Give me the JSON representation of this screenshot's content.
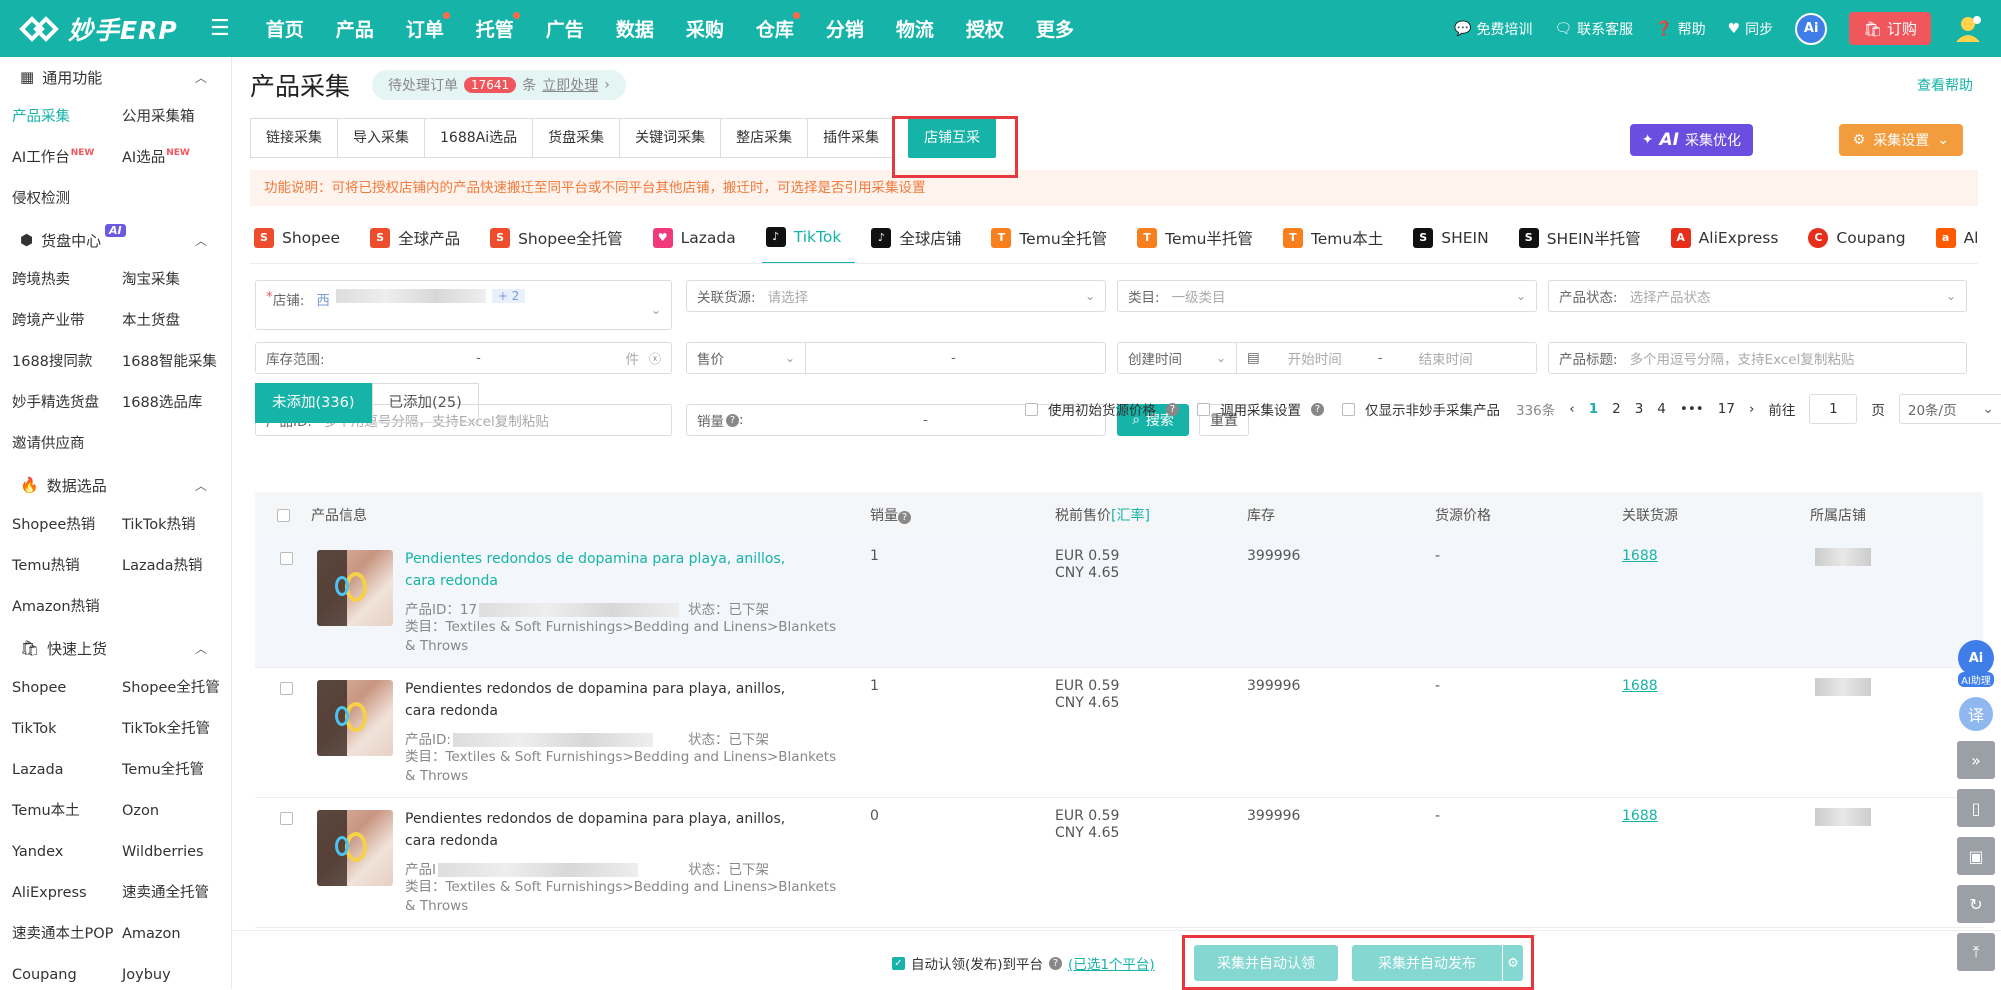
{
  "brand": {
    "name": "妙手ERP"
  },
  "nav": [
    {
      "label": "首页",
      "dot": false
    },
    {
      "label": "产品",
      "dot": false
    },
    {
      "label": "订单",
      "dot": true
    },
    {
      "label": "托管",
      "dot": true
    },
    {
      "label": "广告",
      "dot": false
    },
    {
      "label": "数据",
      "dot": false
    },
    {
      "label": "采购",
      "dot": false
    },
    {
      "label": "仓库",
      "dot": true
    },
    {
      "label": "分销",
      "dot": false
    },
    {
      "label": "物流",
      "dot": false
    },
    {
      "label": "授权",
      "dot": false
    },
    {
      "label": "更多",
      "dot": false
    }
  ],
  "topright": {
    "training": "免费培训",
    "service": "联系客服",
    "help": "帮助",
    "sync": "同步",
    "ai": "Ai",
    "order": "订购"
  },
  "sidebar": {
    "sections": [
      {
        "title": "通用功能",
        "icon": "grid-icon",
        "items": [
          {
            "label": "产品采集",
            "active": true,
            "new": false
          },
          {
            "label": "公用采集箱",
            "active": false,
            "new": false
          },
          {
            "label": "AI工作台",
            "active": false,
            "new": true
          },
          {
            "label": "AI选品",
            "active": false,
            "new": true
          },
          {
            "label": "侵权检测",
            "active": false,
            "new": false
          }
        ]
      },
      {
        "title": "货盘中心",
        "icon": "cube-icon",
        "tag": "AI",
        "items": [
          {
            "label": "跨境热卖"
          },
          {
            "label": "淘宝采集"
          },
          {
            "label": "跨境产业带"
          },
          {
            "label": "本土货盘"
          },
          {
            "label": "1688搜同款"
          },
          {
            "label": "1688智能采集"
          },
          {
            "label": "妙手精选货盘"
          },
          {
            "label": "1688选品库"
          },
          {
            "label": "邀请供应商"
          }
        ]
      },
      {
        "title": "数据选品",
        "icon": "fire-icon",
        "items": [
          {
            "label": "Shopee热销"
          },
          {
            "label": "TikTok热销"
          },
          {
            "label": "Temu热销"
          },
          {
            "label": "Lazada热销"
          },
          {
            "label": "Amazon热销"
          }
        ]
      },
      {
        "title": "快速上货",
        "icon": "bag-icon",
        "items": [
          {
            "label": "Shopee"
          },
          {
            "label": "Shopee全托管"
          },
          {
            "label": "TikTok"
          },
          {
            "label": "TikTok全托管"
          },
          {
            "label": "Lazada"
          },
          {
            "label": "Temu全托管"
          },
          {
            "label": "Temu本土"
          },
          {
            "label": "Ozon"
          },
          {
            "label": "Yandex"
          },
          {
            "label": "Wildberries"
          },
          {
            "label": "AliExpress"
          },
          {
            "label": "速卖通全托管"
          },
          {
            "label": "速卖通本土POP"
          },
          {
            "label": "Amazon"
          },
          {
            "label": "Coupang"
          },
          {
            "label": "Joybuy"
          }
        ]
      }
    ]
  },
  "page": {
    "title": "产品采集",
    "pending_label": "待处理订单",
    "pending_count": "17641",
    "pending_unit": "条",
    "pending_link": "立即处理",
    "help": "查看帮助"
  },
  "tabs": [
    "链接采集",
    "导入采集",
    "1688Ai选品",
    "货盘采集",
    "关键词采集",
    "整店采集",
    "插件采集",
    "店铺互采"
  ],
  "ai_opt": {
    "ai": "AI",
    "label": "采集优化"
  },
  "collect_set": "采集设置",
  "notice": "功能说明：可将已授权店铺内的产品快速搬迁至同平台或不同平台其他店铺，搬迁时，可选择是否引用采集设置",
  "platforms": [
    {
      "label": "Shopee",
      "color": "#ee4d2d"
    },
    {
      "label": "全球产品",
      "color": "#ee4d2d"
    },
    {
      "label": "Shopee全托管",
      "color": "#ee4d2d"
    },
    {
      "label": "Lazada",
      "color": "#f0387a"
    },
    {
      "label": "TikTok",
      "color": "#111111",
      "active": true
    },
    {
      "label": "全球店铺",
      "color": "#111111"
    },
    {
      "label": "Temu全托管",
      "color": "#f77f1e"
    },
    {
      "label": "Temu半托管",
      "color": "#f77f1e"
    },
    {
      "label": "Temu本土",
      "color": "#f77f1e"
    },
    {
      "label": "SHEIN",
      "color": "#111111"
    },
    {
      "label": "SHEIN半托管",
      "color": "#111111"
    },
    {
      "label": "AliExpress",
      "color": "#e62e1b"
    },
    {
      "label": "Coupang",
      "color": "#e62e1b"
    },
    {
      "label": "Allegro",
      "color": "#ff5a00"
    }
  ],
  "filters": {
    "store_label": "店铺:",
    "store_value": "西",
    "store_more": "+ 2",
    "source_label": "关联货源:",
    "source_ph": "请选择",
    "cat_label": "类目:",
    "cat_ph": "一级类目",
    "status_label": "产品状态:",
    "status_ph": "选择产品状态",
    "stock_label": "库存范围:",
    "stock_dash": "-",
    "stock_unit": "件",
    "price_label": "售价",
    "price_dash": "-",
    "created_label": "创建时间",
    "start_ph": "开始时间",
    "end_ph": "结束时间",
    "date_dash": "-",
    "title_label": "产品标题:",
    "title_ph": "多个用逗号分隔，支持Excel复制粘贴",
    "pid_label": "产品ID:",
    "pid_ph": "多个用逗号分隔，支持Excel复制粘贴",
    "sales_label": "销量",
    "sales_dash": "-",
    "search": "搜索",
    "reset": "重置"
  },
  "list_tabs": {
    "unadded": "未添加(336)",
    "added": "已添加(25)"
  },
  "options": {
    "opt1": "使用初始货源价格",
    "opt2": "调用采集设置",
    "opt3": "仅显示非妙手采集产品"
  },
  "pager": {
    "total": "336条",
    "pages": [
      "1",
      "2",
      "3",
      "4",
      "•••",
      "17"
    ],
    "goto": "前往",
    "page_val": "1",
    "page_unit": "页",
    "size": "20条/页"
  },
  "table": {
    "headers": {
      "info": "产品信息",
      "sales": "销量",
      "price": "税前售价",
      "rate": "[汇率]",
      "stock": "库存",
      "source_price": "货源价格",
      "source": "关联货源",
      "shop": "所属店铺"
    },
    "rows": [
      {
        "title": "Pendientes redondos de dopamina para playa, anillos, cara redonda",
        "title_link": true,
        "pid_label": "产品ID：",
        "pid_prefix": "17",
        "state": "状态：已下架",
        "cat": "类目：Textiles & Soft Furnishings>Bedding and Linens>Blankets & Throws",
        "sales": "1",
        "eur": "EUR 0.59",
        "cny": "CNY 4.65",
        "stock": "399996",
        "source_price": "-",
        "source": "1688"
      },
      {
        "title": "Pendientes redondos de dopamina para playa, anillos, cara redonda",
        "title_link": false,
        "pid_label": "产品ID:",
        "pid_prefix": "",
        "state": "状态：已下架",
        "cat": "类目：Textiles & Soft Furnishings>Bedding and Linens>Blankets & Throws",
        "sales": "1",
        "eur": "EUR 0.59",
        "cny": "CNY 4.65",
        "stock": "399996",
        "source_price": "-",
        "source": "1688"
      },
      {
        "title": "Pendientes redondos de dopamina para playa, anillos, cara redonda",
        "title_link": false,
        "pid_label": "产品I",
        "pid_prefix": "",
        "state": "状态：已下架",
        "cat": "类目：Textiles & Soft Furnishings>Bedding and Linens>Blankets & Throws",
        "sales": "0",
        "eur": "EUR 0.59",
        "cny": "CNY 4.65",
        "stock": "399996",
        "source_price": "-",
        "source": "1688"
      }
    ]
  },
  "bottom": {
    "auto_label": "自动认领(发布)到平台",
    "selected": "(已选1个平台)",
    "btn1": "采集并自动认领",
    "btn2": "采集并自动发布"
  },
  "floats": {
    "ai": "Ai",
    "ai_assist": "AI助理",
    "translate": "译"
  }
}
